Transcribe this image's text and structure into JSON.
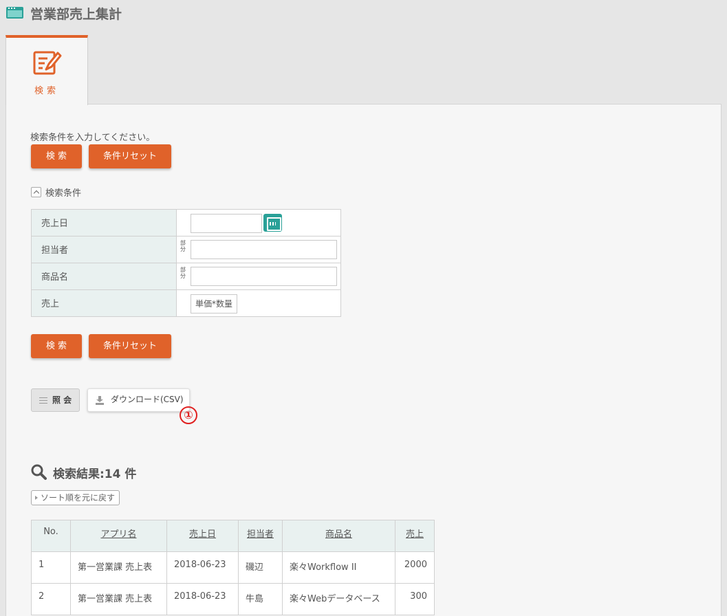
{
  "header": {
    "title": "営業部売上集計"
  },
  "tab": {
    "label": "検索"
  },
  "search": {
    "instruction": "検索条件を入力してください。",
    "search_label": "検 索",
    "reset_label": "条件リセット",
    "section_label": "検索条件",
    "fields": [
      {
        "label": "売上日",
        "type": "date",
        "value": ""
      },
      {
        "label": "担当者",
        "type": "text",
        "match": "部分",
        "value": ""
      },
      {
        "label": "商品名",
        "type": "text",
        "match": "部分",
        "value": ""
      },
      {
        "label": "売上",
        "type": "chip",
        "chip": "単価*数量"
      }
    ],
    "match_chars": [
      "部",
      "分"
    ]
  },
  "actions": {
    "view_label": "照 会",
    "download_label": "ダウンロード(CSV)",
    "marker": "①"
  },
  "results": {
    "title": "検索結果:14 件",
    "sort_reset_label": "ソート順を元に戻す",
    "columns": [
      "No.",
      "アプリ名",
      "売上日",
      "担当者",
      "商品名",
      "売上"
    ],
    "rows": [
      [
        "1",
        "第一営業課 売上表",
        "2018-06-23",
        "磯辺",
        "楽々Workflow II",
        "2000"
      ],
      [
        "2",
        "第一営業課 売上表",
        "2018-06-23",
        "牛島",
        "楽々Webデータベース",
        "300"
      ]
    ]
  },
  "colors": {
    "accent": "#e0622a",
    "teal": "#2aa198",
    "label_bg": "#e9f1f0",
    "marker": "#e02020"
  }
}
